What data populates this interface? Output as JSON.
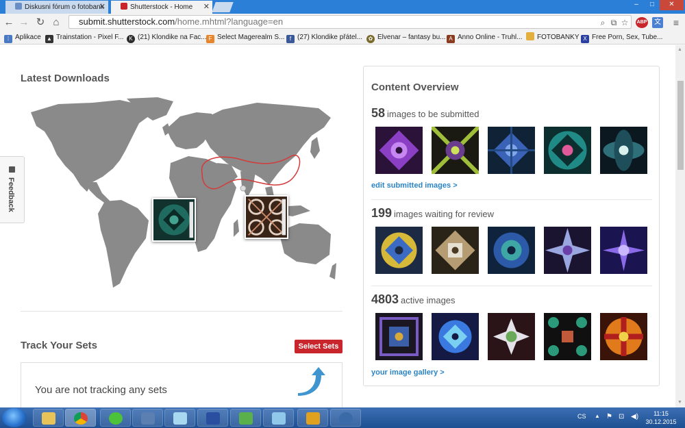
{
  "browser": {
    "tabs": [
      {
        "title": "Diskusni fórum o fotobank",
        "active": false
      },
      {
        "title": "Shutterstock - Home",
        "active": true
      }
    ],
    "window_controls": {
      "minimize": "–",
      "maximize": "□",
      "close": "✕"
    },
    "url": {
      "host": "submit.shutterstock.com",
      "path": "/home.mhtml?language=en"
    },
    "bookmarks": [
      {
        "label": "Aplikace",
        "icon": "apps-grid-icon",
        "color": "#4a79c4"
      },
      {
        "label": "Trainstation - Pixel F...",
        "icon": "trainstation-icon",
        "color": "#333333"
      },
      {
        "label": "(21) Klondike na Fac...",
        "icon": "klondike-icon",
        "color": "#2b2b2b"
      },
      {
        "label": "Select Magerealm S...",
        "icon": "magerealm-icon",
        "color": "#e8852b"
      },
      {
        "label": "(27) Klondike přátel...",
        "icon": "facebook-icon",
        "color": "#3b5998"
      },
      {
        "label": "Elvenar – fantasy bu...",
        "icon": "elvenar-icon",
        "color": "#7a6a2a"
      },
      {
        "label": "Anno Online - Truhl...",
        "icon": "anno-icon",
        "color": "#8a3b1f"
      },
      {
        "label": "FOTOBANKY",
        "icon": "folder-icon",
        "color": "#e3b040"
      },
      {
        "label": "Free Porn, Sex, Tube...",
        "icon": "x-site-icon",
        "color": "#2a3fa0"
      }
    ]
  },
  "page": {
    "latest_downloads": {
      "heading": "Latest Downloads"
    },
    "track_sets": {
      "heading": "Track Your Sets",
      "button": "Select Sets",
      "empty_message": "You are not tracking any sets"
    },
    "feedback_tab": "Feedback",
    "content_overview": {
      "heading": "Content Overview",
      "sections": [
        {
          "count": "58",
          "label": "images to be submitted",
          "link": "edit submitted images >"
        },
        {
          "count": "199",
          "label": "images waiting for review",
          "link": ""
        },
        {
          "count": "4803",
          "label": "active images",
          "link": "your image gallery >"
        }
      ]
    }
  },
  "taskbar": {
    "apps": [
      "explorer",
      "chrome",
      "icq",
      "scanner",
      "notepad",
      "save",
      "greenapp",
      "notebook",
      "games",
      "dreamweaver"
    ],
    "language": "CS",
    "time": "11:15",
    "date": "30.12.2015"
  },
  "colors": {
    "accent_red": "#c8262c",
    "link_blue": "#2a84c4",
    "map_gray": "#8a8a8a"
  }
}
